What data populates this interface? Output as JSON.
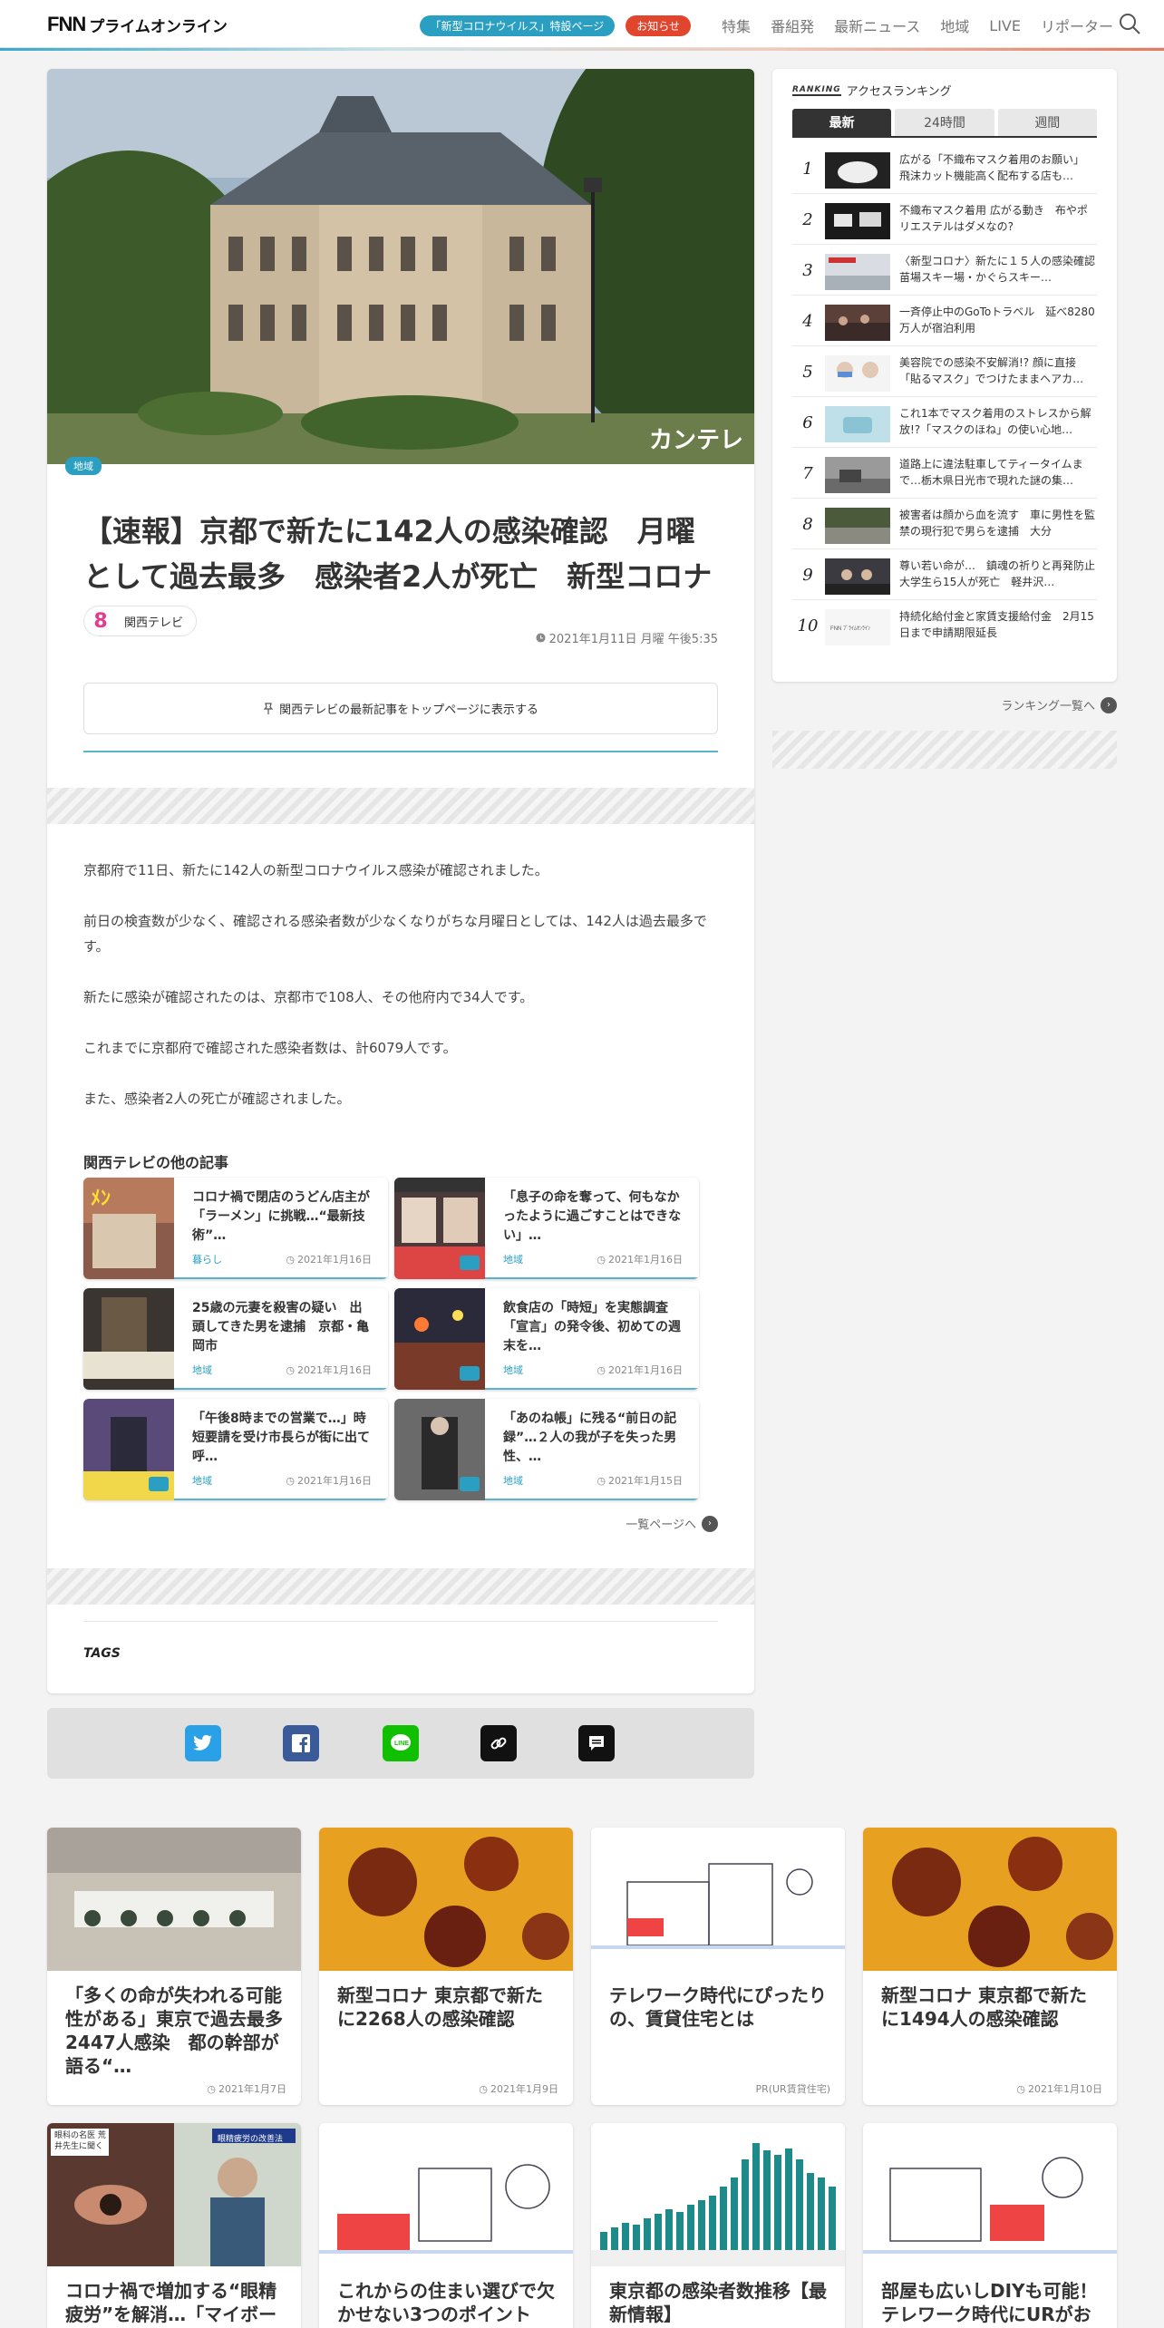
{
  "header": {
    "logo": "FNN",
    "logo_sub": "プライムオンライン",
    "covid_pill": "「新型コロナウイルス」特設ページ",
    "notice_pill": "お知らせ",
    "nav": [
      "特集",
      "番組発",
      "最新ニュース",
      "地域",
      "LIVE",
      "リポーター"
    ]
  },
  "article": {
    "hero_caption": "カンテレ",
    "category": "地域",
    "title": "【速報】京都で新たに142人の感染確認　月曜として過去最多　感染者2人が死亡　新型コロナ",
    "publisher": "関西テレビ",
    "date": "2021年1月11日 月曜 午後5:35",
    "pin_text": "関西テレビの最新記事をトップページに表示する",
    "paragraphs": [
      "京都府で11日、新たに142人の新型コロナウイルス感染が確認されました。",
      "前日の検査数が少なく、確認される感染者数が少なくなりがちな月曜日としては、142人は過去最多です。",
      "新たに感染が確認されたのは、京都市で108人、その他府内で34人です。",
      "これまでに京都府で確認された感染者数は、計6079人です。",
      "また、感染者2人の死亡が確認されました。"
    ],
    "related_heading": "関西テレビの他の記事",
    "related": [
      {
        "title": "コロナ禍で閉店のうどん店主が「ラーメン」に挑戦…“最新技術”…",
        "cat": "暮らし",
        "date": "2021年1月16日"
      },
      {
        "title": "「息子の命を奪って、何もなかったように過ごすことはできない」…",
        "cat": "地域",
        "date": "2021年1月16日"
      },
      {
        "title": "25歳の元妻を殺害の疑い　出頭してきた男を逮捕　京都・亀岡市",
        "cat": "地域",
        "date": "2021年1月16日"
      },
      {
        "title": "飲食店の「時短」を実態調査　「宣言」の発令後、初めての週末を…",
        "cat": "地域",
        "date": "2021年1月16日"
      },
      {
        "title": "「午後8時までの営業で…」時短要請を受け市長らが街に出て呼…",
        "cat": "地域",
        "date": "2021年1月16日"
      },
      {
        "title": "「あのね帳」に残る“前日の記録”…２人の我が子を失った男性、…",
        "cat": "地域",
        "date": "2021年1月15日"
      }
    ],
    "more_label": "一覧ページへ",
    "tags_label": "TAGS"
  },
  "share": [
    "twitter",
    "facebook",
    "line",
    "link",
    "comment"
  ],
  "ranking": {
    "label": "RANKING",
    "title": "アクセスランキング",
    "tabs": [
      "最新",
      "24時間",
      "週間"
    ],
    "items": [
      {
        "n": "1",
        "text": "広がる「不織布マスク着用のお願い」　飛沫カット機能高く配布する店も…"
      },
      {
        "n": "2",
        "text": "不織布マスク着用 広がる動き　布やポリエステルはダメなの?"
      },
      {
        "n": "3",
        "text": "〈新型コロナ〉新たに１５人の感染確認　苗場スキー場・かぐらスキー…"
      },
      {
        "n": "4",
        "text": "一斉停止中のGoToトラベル　延べ8280万人が宿泊利用"
      },
      {
        "n": "5",
        "text": "美容院での感染不安解消!? 顔に直接「貼るマスク」でつけたままヘアカ…"
      },
      {
        "n": "6",
        "text": "これ1本でマスク着用のストレスから解放!?「マスクのほね」の使い心地…"
      },
      {
        "n": "7",
        "text": "道路上に違法駐車してティータイムまで…栃木県日光市で現れた謎の集…"
      },
      {
        "n": "8",
        "text": "被害者は顔から血を流す　車に男性を監禁の現行犯で男らを逮捕　大分"
      },
      {
        "n": "9",
        "text": "尊い若い命が…　鎮魂の祈りと再発防止　大学生ら15人が死亡　軽井沢…"
      },
      {
        "n": "10",
        "text": "持続化給付金と家賃支援給付金　2月15日まで申請期限延長"
      }
    ],
    "more_label": "ランキング一覧へ"
  },
  "cards": [
    {
      "title": "「多くの命が失われる可能性がある」東京で過去最多2447人感染　都の幹部が語る“…",
      "date": "2021年1月7日"
    },
    {
      "title": "新型コロナ 東京都で新たに2268人の感染確認",
      "date": "2021年1月9日"
    },
    {
      "title": "テレワーク時代にぴったりの、賃貸住宅とは",
      "date": "PR(UR賃貸住宅)"
    },
    {
      "title": "新型コロナ 東京都で新たに1494人の感染確認",
      "date": "2021年1月10日"
    },
    {
      "title": "コロナ禍で増加する“眼精疲労”を解消…「マイボー",
      "date": ""
    },
    {
      "title": "これからの住まい選びで欠かせない3つのポイント",
      "date": ""
    },
    {
      "title": "東京都の感染者数推移【最新情報】",
      "date": ""
    },
    {
      "title": "部屋も広いしDIYも可能！テレワーク時代にURがお",
      "date": ""
    }
  ],
  "card_overlays": {
    "eye_label": "眼科の名医 荒井先生に聞く",
    "eye_label2": "眼精疲労の改善法"
  }
}
